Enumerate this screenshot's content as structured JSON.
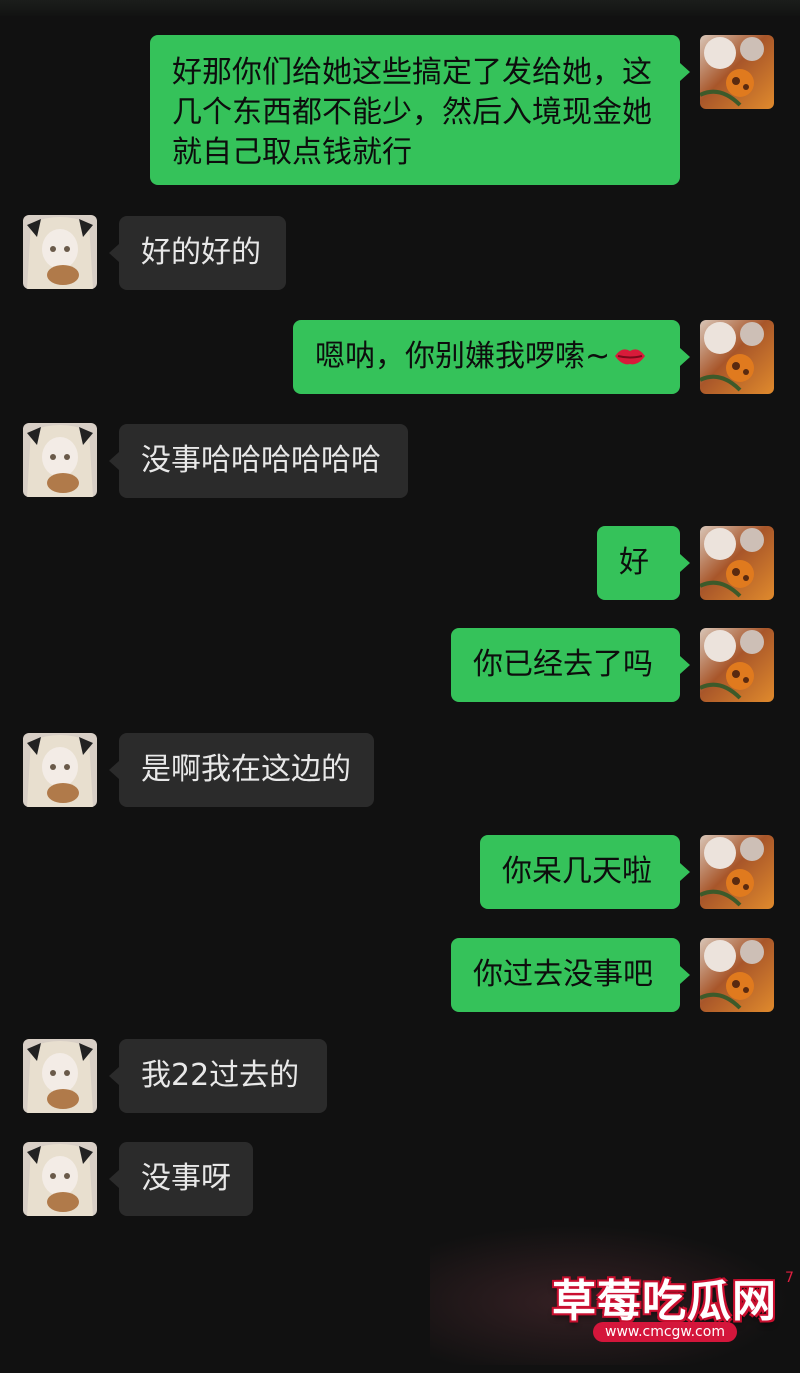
{
  "chat": {
    "messages": [
      {
        "side": "out",
        "lines": [
          "好那你们给她这些搞定了发给她，这",
          "几个东西都不能少，然后入境现金她",
          "就自己取点钱就行"
        ]
      },
      {
        "side": "in",
        "text": "好的好的"
      },
      {
        "side": "out",
        "text": "嗯呐，你别嫌我啰嗦~",
        "emoji": "lips-icon"
      },
      {
        "side": "in",
        "text": "没事哈哈哈哈哈哈"
      },
      {
        "side": "out",
        "text": "好"
      },
      {
        "side": "out",
        "text": "你已经去了吗"
      },
      {
        "side": "in",
        "text": "是啊我在这边的"
      },
      {
        "side": "out",
        "text": "你呆几天啦"
      },
      {
        "side": "out",
        "text": "你过去没事吧"
      },
      {
        "side": "in",
        "text": "我22过去的"
      },
      {
        "side": "in",
        "text": "没事呀"
      }
    ]
  },
  "watermark": {
    "title": "草莓吃瓜网",
    "url": "www.cmcgw.com",
    "mark": "7"
  },
  "colors": {
    "background": "#111111",
    "outgoing_bubble": "#35c25a",
    "incoming_bubble": "#2b2b2b",
    "watermark_red": "#d4163b"
  }
}
